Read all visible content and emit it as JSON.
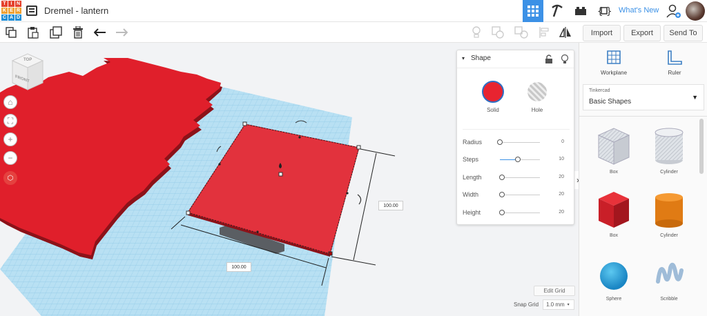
{
  "app": {
    "title": "Dremel - lantern",
    "logo_letters": [
      "T",
      "I",
      "N",
      "K",
      "E",
      "R",
      "C",
      "A",
      "D"
    ]
  },
  "topbar": {
    "whats_new": "What's New"
  },
  "toolbar": {
    "import": "Import",
    "export": "Export",
    "send_to": "Send To"
  },
  "view_cube": {
    "top": "TOP",
    "front": "FRONT"
  },
  "shape_panel": {
    "title": "Shape",
    "solid_label": "Solid",
    "hole_label": "Hole",
    "params": [
      {
        "label": "Radius",
        "value": "0",
        "level": 0.0
      },
      {
        "label": "Steps",
        "value": "10",
        "level": 0.45
      },
      {
        "label": "Length",
        "value": "20",
        "level": 0.05
      },
      {
        "label": "Width",
        "value": "20",
        "level": 0.05
      },
      {
        "label": "Height",
        "value": "20",
        "level": 0.05
      }
    ]
  },
  "dimensions": {
    "width_label": "100.00",
    "depth_label": "100.00"
  },
  "grid": {
    "edit_grid": "Edit Grid",
    "snap_label": "Snap Grid",
    "snap_value": "1.0 mm"
  },
  "right_panel": {
    "workplane": "Workplane",
    "ruler": "Ruler",
    "library_category": "Tinkercad",
    "library_name": "Basic Shapes",
    "shapes": [
      "Box",
      "Cylinder",
      "Box",
      "Cylinder",
      "Sphere",
      "Scribble"
    ]
  },
  "colors": {
    "accent": "#3c91e6",
    "solid": "#e0202b",
    "workplane": "#a8d8ef"
  }
}
